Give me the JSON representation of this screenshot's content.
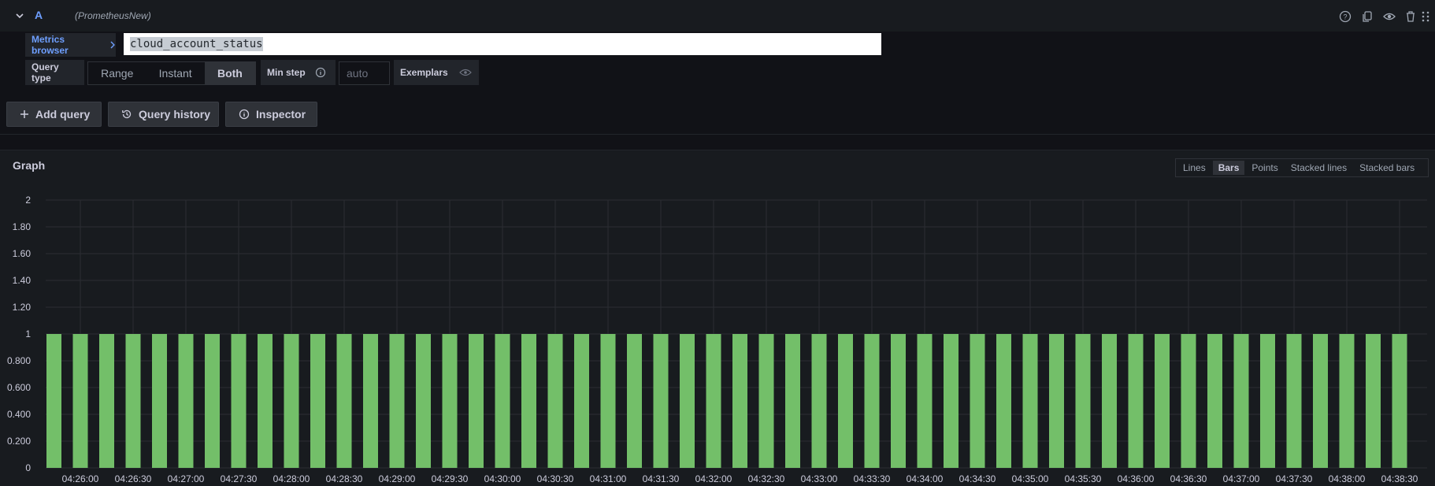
{
  "query_row": {
    "ref_id": "A",
    "datasource": "(PrometheusNew)"
  },
  "metrics_browser": {
    "label": "Metrics browser"
  },
  "query": {
    "expr": "cloud_account_status"
  },
  "options": {
    "query_type_label": "Query type",
    "query_types": [
      "Range",
      "Instant",
      "Both"
    ],
    "selected_query_type": "Both",
    "min_step_label": "Min step",
    "min_step_placeholder": "auto",
    "exemplars_label": "Exemplars"
  },
  "actions": {
    "add_query": "Add query",
    "query_history": "Query history",
    "inspector": "Inspector"
  },
  "graph": {
    "title": "Graph",
    "viz_options": [
      "Lines",
      "Bars",
      "Points",
      "Stacked lines",
      "Stacked bars"
    ],
    "selected_viz": "Bars"
  },
  "colors": {
    "bar": "#73bf69",
    "accent": "#6e9fff"
  },
  "chart_data": {
    "type": "bar",
    "ylim": [
      0,
      2
    ],
    "y_ticks": [
      "0",
      "0.200",
      "0.400",
      "0.600",
      "0.800",
      "1",
      "1.20",
      "1.40",
      "1.60",
      "1.80",
      "2"
    ],
    "x_ticks": [
      "04:26:00",
      "04:26:30",
      "04:27:00",
      "04:27:30",
      "04:28:00",
      "04:28:30",
      "04:29:00",
      "04:29:30",
      "04:30:00",
      "04:30:30",
      "04:31:00",
      "04:31:30",
      "04:32:00",
      "04:32:30",
      "04:33:00",
      "04:33:30",
      "04:34:00",
      "04:34:30",
      "04:35:00",
      "04:35:30",
      "04:36:00",
      "04:36:30",
      "04:37:00",
      "04:37:30",
      "04:38:00",
      "04:38:30"
    ],
    "values": [
      1,
      1,
      1,
      1,
      1,
      1,
      1,
      1,
      1,
      1,
      1,
      1,
      1,
      1,
      1,
      1,
      1,
      1,
      1,
      1,
      1,
      1,
      1,
      1,
      1,
      1,
      1,
      1,
      1,
      1,
      1,
      1,
      1,
      1,
      1,
      1,
      1,
      1,
      1,
      1,
      1,
      1,
      1,
      1,
      1,
      1,
      1,
      1,
      1,
      1,
      1,
      1
    ],
    "grid": true
  }
}
